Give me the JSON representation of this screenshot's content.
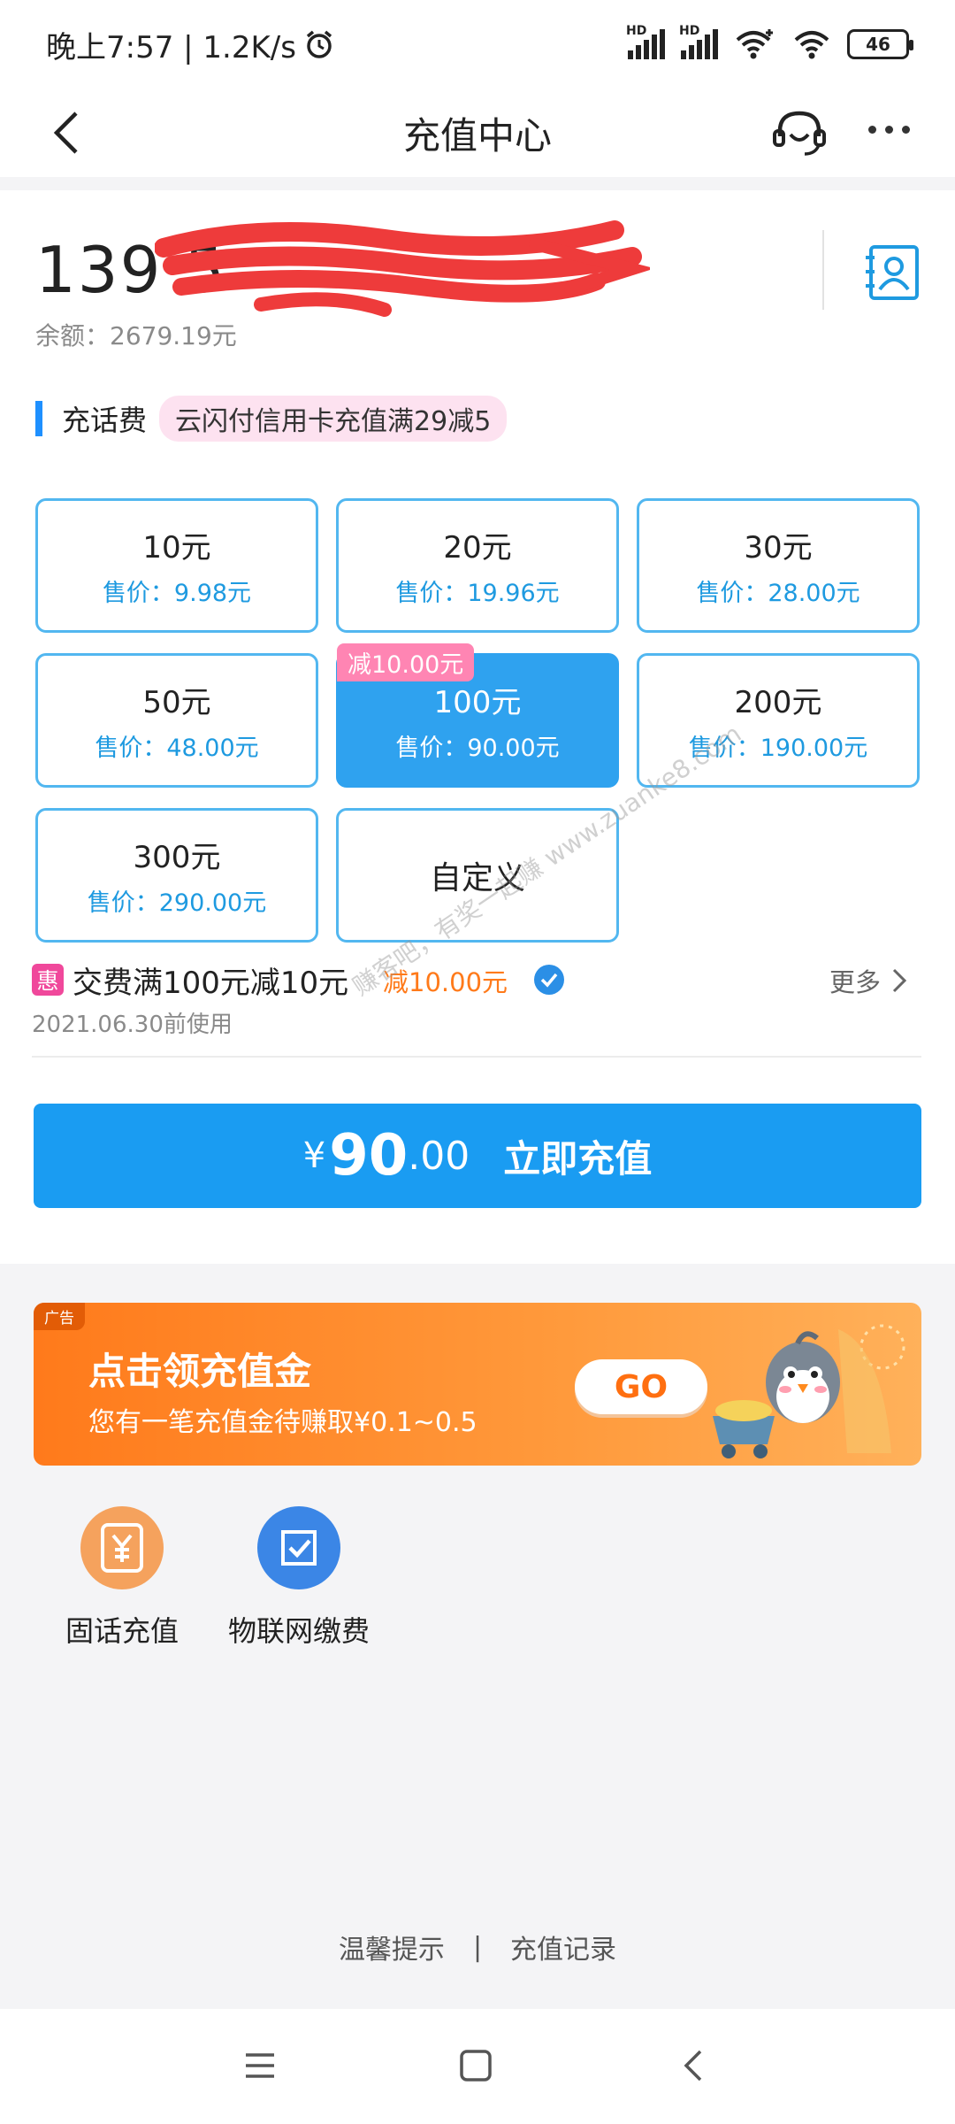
{
  "status_bar": {
    "time_speed": "晚上7:57 | 1.2K/s",
    "battery": "46"
  },
  "header": {
    "title": "充值中心"
  },
  "account": {
    "phone_visible": "139 5",
    "balance": "余额：2679.19元"
  },
  "recharge": {
    "section_title": "充话费",
    "promo_tag": "云闪付信用卡充值满29减5",
    "options": [
      {
        "face": "10元",
        "price": "售价：9.98元"
      },
      {
        "face": "20元",
        "price": "售价：19.96元"
      },
      {
        "face": "30元",
        "price": "售价：28.00元"
      },
      {
        "face": "50元",
        "price": "售价：48.00元"
      },
      {
        "face": "100元",
        "price": "售价：90.00元",
        "badge": "减10.00元",
        "selected": true
      },
      {
        "face": "200元",
        "price": "售价：190.00元"
      },
      {
        "face": "300元",
        "price": "售价：290.00元"
      },
      {
        "face": "自定义"
      }
    ]
  },
  "coupon": {
    "icon_text": "惠",
    "title": "交费满100元减10元",
    "amount": "减10.00元",
    "date": "2021.06.30前使用",
    "more": "更多"
  },
  "pay_button": {
    "currency": "¥",
    "amount_int": "90",
    "amount_dec": ".00",
    "label": "立即充值"
  },
  "watermark": "赚客吧，有奖一起赚 www.zuanke8.com",
  "ad": {
    "tag": "广告",
    "title": "点击领充值金",
    "subtitle": "您有一笔充值金待赚取¥0.1~0.5",
    "go": "GO"
  },
  "shortcuts": [
    {
      "label": "固话充值",
      "icon": "landline-yuan-icon",
      "color": "#f5a25d"
    },
    {
      "label": "物联网缴费",
      "icon": "iot-check-icon",
      "color": "#3b86e6"
    }
  ],
  "footer": {
    "tips": "温馨提示",
    "separator": "|",
    "records": "充值记录"
  },
  "colors": {
    "accent": "#1a9cf2",
    "tile_border": "#52b7f0",
    "badge_pink": "#ff85b3",
    "coupon_orange": "#ff7a1a"
  }
}
